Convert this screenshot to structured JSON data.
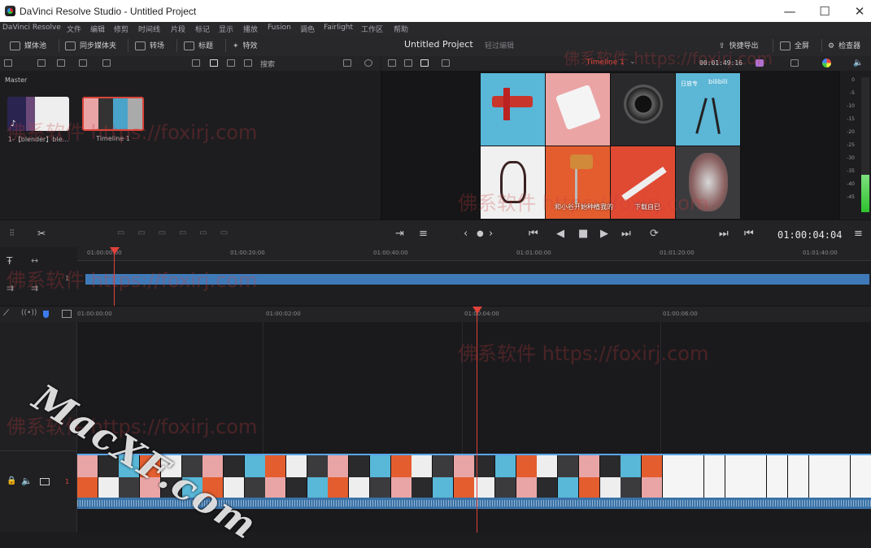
{
  "window": {
    "title": "DaVinci Resolve Studio - Untitled Project",
    "minimize": "—",
    "maximize": "☐",
    "close": "✕"
  },
  "menu": [
    "DaVinci Resolve",
    "文件",
    "编辑",
    "修剪",
    "时间线",
    "片段",
    "标记",
    "显示",
    "播放",
    "Fusion",
    "调色",
    "Fairlight",
    "工作区",
    "帮助"
  ],
  "toolbar": {
    "media_pool": "媒体池",
    "sync_bin": "同步媒体夹",
    "transitions": "转场",
    "titles": "标题",
    "effects": "特效",
    "project_title": "Untitled Project",
    "edit_mode": "轻过编辑",
    "quick_export": "快捷导出",
    "fullscreen": "全屏",
    "inspector": "检查器"
  },
  "subbar": {
    "search": "搜索",
    "timeline_name": "Timeline 1",
    "source_timecode": "00:01:49:16"
  },
  "media_pool": {
    "bin": "Master",
    "clips": [
      {
        "caption": "1-【blender】ble..."
      },
      {
        "caption": "Timeline 1"
      }
    ]
  },
  "viewer": {
    "caption_left": "和小谷开始种植我的",
    "caption_right": "下载自已",
    "brand_left": "日放专",
    "brand_right": "bilibili"
  },
  "transport": {
    "timecode": "01:00:04:04"
  },
  "upper_ruler": [
    "01:00:00:00",
    "01:00:20:00",
    "01:00:40:00",
    "01:01:00:00",
    "01:01:20:00",
    "01:01:40:00"
  ],
  "upper_track_number": "1",
  "lower_ruler": [
    "01:00:00:00",
    "01:00:02:00",
    "01:00:04:00",
    "01:00:06:00"
  ],
  "lower_track_number": "1",
  "meter": {
    "scale": [
      "0",
      "-5",
      "-10",
      "-15",
      "-20",
      "-25",
      "-30",
      "-35",
      "-40",
      "-45"
    ],
    "level": 0.28
  },
  "watermarks": {
    "foxirj": "佛系软件 https://foxirj.com",
    "macxf": "MacXF.com"
  },
  "colors": {
    "accent": "#e0423a",
    "track_blue": "#3f7ab8",
    "timeline_red": "#d9453a"
  }
}
